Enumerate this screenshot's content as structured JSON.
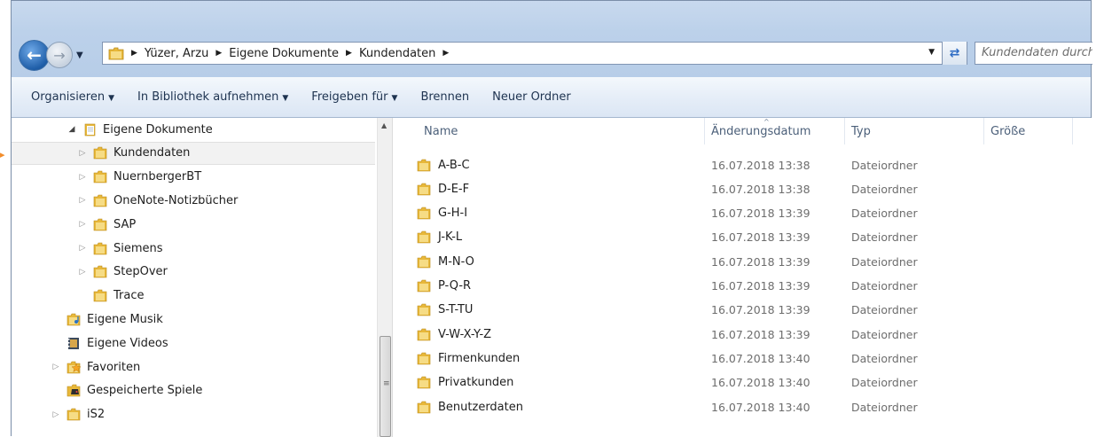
{
  "address_bar": {
    "crumbs": [
      "Yüzer, Arzu",
      "Eigene Dokumente",
      "Kundendaten"
    ],
    "search_placeholder": "Kundendaten durchsuchen"
  },
  "command_bar": {
    "organize": "Organisieren",
    "add_to_library": "In Bibliothek aufnehmen",
    "share_with": "Freigeben für",
    "burn": "Brennen",
    "new_folder": "Neuer Ordner"
  },
  "nav_tree": [
    {
      "label": "Eigene Dokumente",
      "icon": "documents-library-icon",
      "expander": "open"
    },
    {
      "label": "Kundendaten",
      "icon": "folder-icon",
      "expander": "closed",
      "selected": true
    },
    {
      "label": "NuernbergerBT",
      "icon": "folder-icon",
      "expander": "closed"
    },
    {
      "label": "OneNote-Notizbücher",
      "icon": "folder-icon",
      "expander": "closed"
    },
    {
      "label": "SAP",
      "icon": "folder-icon",
      "expander": "closed"
    },
    {
      "label": "Siemens",
      "icon": "folder-icon",
      "expander": "closed"
    },
    {
      "label": "StepOver",
      "icon": "folder-icon",
      "expander": "closed"
    },
    {
      "label": "Trace",
      "icon": "folder-icon",
      "expander": "none"
    },
    {
      "label": "Eigene Musik",
      "icon": "music-folder-icon",
      "expander": "none"
    },
    {
      "label": "Eigene Videos",
      "icon": "video-folder-icon",
      "expander": "none"
    },
    {
      "label": "Favoriten",
      "icon": "favorites-folder-icon",
      "expander": "closed"
    },
    {
      "label": "Gespeicherte Spiele",
      "icon": "saved-games-icon",
      "expander": "none"
    },
    {
      "label": "iS2",
      "icon": "folder-icon",
      "expander": "closed"
    }
  ],
  "columns": {
    "name": "Name",
    "date": "Änderungsdatum",
    "type": "Typ",
    "size": "Größe"
  },
  "files": [
    {
      "name": "A-B-C",
      "date": "16.07.2018 13:38",
      "type": "Dateiordner"
    },
    {
      "name": "D-E-F",
      "date": "16.07.2018 13:38",
      "type": "Dateiordner"
    },
    {
      "name": "G-H-I",
      "date": "16.07.2018 13:39",
      "type": "Dateiordner"
    },
    {
      "name": "J-K-L",
      "date": "16.07.2018 13:39",
      "type": "Dateiordner"
    },
    {
      "name": "M-N-O",
      "date": "16.07.2018 13:39",
      "type": "Dateiordner"
    },
    {
      "name": "P-Q-R",
      "date": "16.07.2018 13:39",
      "type": "Dateiordner"
    },
    {
      "name": "S-T-TU",
      "date": "16.07.2018 13:39",
      "type": "Dateiordner"
    },
    {
      "name": "V-W-X-Y-Z",
      "date": "16.07.2018 13:39",
      "type": "Dateiordner"
    },
    {
      "name": "Firmenkunden",
      "date": "16.07.2018 13:40",
      "type": "Dateiordner"
    },
    {
      "name": "Privatkunden",
      "date": "16.07.2018 13:40",
      "type": "Dateiordner"
    },
    {
      "name": "Benutzerdaten",
      "date": "16.07.2018 13:40",
      "type": "Dateiordner"
    }
  ],
  "colors": {
    "folder": "#e8b83a",
    "accent_blue": "#1f5ea8",
    "selection": "#f2f2f2"
  }
}
